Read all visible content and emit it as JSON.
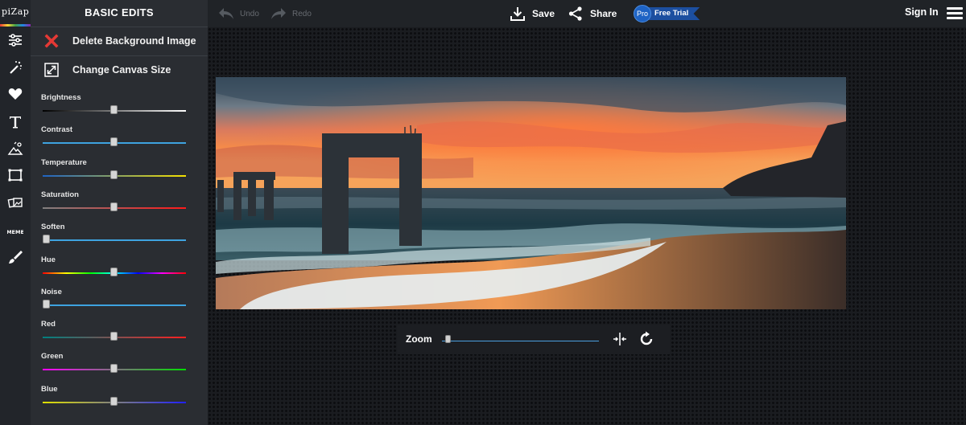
{
  "app": {
    "logo": "piZap"
  },
  "rail": {
    "items": [
      {
        "icon": "adjust-sliders-icon"
      },
      {
        "icon": "magic-wand-icon"
      },
      {
        "icon": "heart-icon"
      },
      {
        "icon": "text-icon"
      },
      {
        "icon": "paint-effects-icon"
      },
      {
        "icon": "border-frame-icon"
      },
      {
        "icon": "collage-icon"
      },
      {
        "icon": "meme-icon",
        "label": "MEME"
      },
      {
        "icon": "brush-icon"
      }
    ]
  },
  "panel": {
    "title": "BASIC EDITS",
    "actions": [
      {
        "label": "Delete Background Image",
        "icon": "delete-x-icon",
        "color": "#e53935"
      },
      {
        "label": "Change Canvas Size",
        "icon": "resize-canvas-icon"
      }
    ],
    "sliders": [
      {
        "label": "Brightness",
        "value": 0.5,
        "track": "linear-gradient(90deg,#000,#fff)"
      },
      {
        "label": "Contrast",
        "value": 0.5,
        "track": "#3ea3e0"
      },
      {
        "label": "Temperature",
        "value": 0.5,
        "track": "linear-gradient(90deg,#1e63c4,#f5e100)"
      },
      {
        "label": "Saturation",
        "value": 0.5,
        "track": "linear-gradient(90deg,#808080,#ff1a1a)"
      },
      {
        "label": "Soften",
        "value": 0.0,
        "track": "#3ea3e0"
      },
      {
        "label": "Hue",
        "value": 0.5,
        "track": "linear-gradient(90deg,#ff0000,#ffff00,#00ff00,#00ffff,#0000ff,#ff00ff,#ff0000)"
      },
      {
        "label": "Noise",
        "value": 0.0,
        "track": "#3ea3e0"
      },
      {
        "label": "Red",
        "value": 0.5,
        "track": "linear-gradient(90deg,#008080,#ff2020)"
      },
      {
        "label": "Green",
        "value": 0.5,
        "track": "linear-gradient(90deg,#ff00ff,#00e000)"
      },
      {
        "label": "Blue",
        "value": 0.5,
        "track": "linear-gradient(90deg,#e0e000,#2020ff)"
      }
    ]
  },
  "toolbar": {
    "undo_label": "Undo",
    "redo_label": "Redo",
    "save_label": "Save",
    "share_label": "Share",
    "pro_label": "Pro",
    "free_trial_label": "Free Trial",
    "signin_label": "Sign In"
  },
  "zoom": {
    "label": "Zoom",
    "value": 0.0
  },
  "colors": {
    "accent": "#3ea3e0",
    "pro_blue": "#1e63c4",
    "delete_red": "#e53935"
  }
}
